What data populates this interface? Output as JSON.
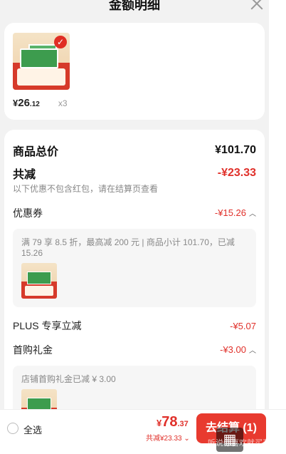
{
  "header": {
    "title": "金额明细"
  },
  "product": {
    "price_symbol": "¥",
    "price_int": "26",
    "price_dec": ".12",
    "quantity": "x3"
  },
  "summary": {
    "total_label": "商品总价",
    "total_value": "¥101.70",
    "reduce_label": "共减",
    "reduce_value": "-¥23.33",
    "note": "以下优惠不包含红包，请在结算页查看"
  },
  "coupon": {
    "label": "优惠券",
    "value": "-¥15.26",
    "detail": "满 79 享 8.5 折，最高减 200 元 | 商品小计 101.70，已减 15.26"
  },
  "plus": {
    "label": "PLUS 专享立减",
    "value": "-¥5.07"
  },
  "first_gift": {
    "label": "首购礼金",
    "value": "-¥3.00",
    "detail": "店铺首购礼金已减 ¥ 3.00"
  },
  "bottom": {
    "select_all": "全选",
    "price_symbol": "¥",
    "price_int": "78",
    "price_dec": ".37",
    "reduce_text": "共减¥23.33",
    "checkout_label": "去结算 (1)"
  },
  "watermark": {
    "icon": "qr-icon",
    "text": "听说你喜欢就买买"
  },
  "colors": {
    "accent_red": "#e0302a",
    "checkout_red": "#e83a2f"
  }
}
